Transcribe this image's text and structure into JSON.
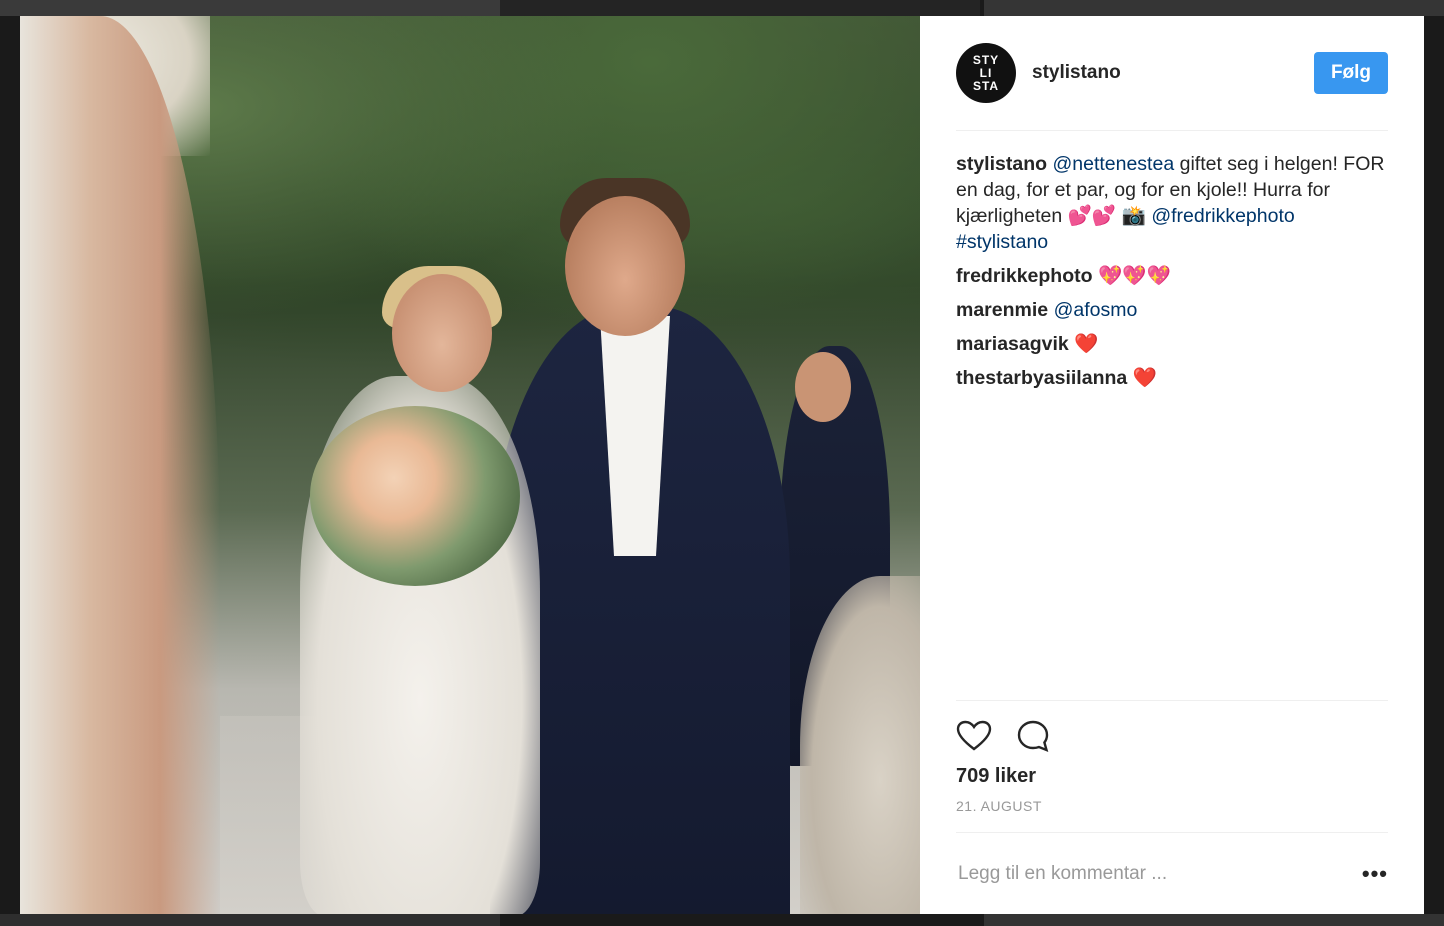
{
  "post": {
    "username": "stylistano",
    "avatar_lines": [
      "STY",
      "LI",
      "STA"
    ],
    "follow_label": "Følg",
    "caption": {
      "user": "stylistano",
      "mention": "@nettenestea",
      "text": "giftet seg i helgen! FOR en dag, for et par, og for en kjole!! Hurra for kjærligheten",
      "emoji": "💕💕 📸",
      "mention2": "@fredrikkephoto",
      "hashtag": "#stylistano"
    },
    "comments": [
      {
        "user": "fredrikkephoto",
        "text": "💖💖💖",
        "mention": ""
      },
      {
        "user": "marenmie",
        "text": "",
        "mention": "@afosmo"
      },
      {
        "user": "mariasagvik",
        "text": "❤️",
        "mention": ""
      },
      {
        "user": "thestarbyasiilanna",
        "text": "❤️",
        "mention": ""
      }
    ],
    "likes": "709 liker",
    "date": "21. AUGUST",
    "comment_placeholder": "Legg til en kommentar ...",
    "more_icon": "•••"
  },
  "colors": {
    "follow_button": "#3897f0",
    "mention": "#003569"
  }
}
